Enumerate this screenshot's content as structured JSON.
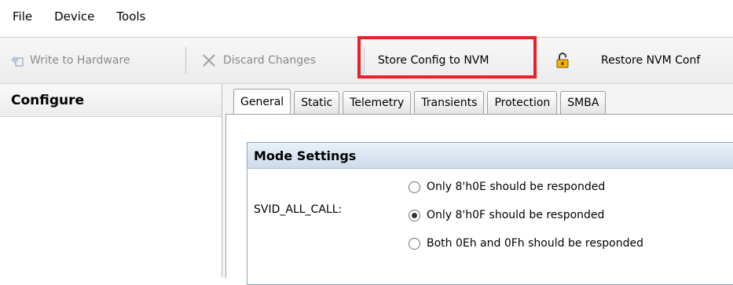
{
  "menu": [
    "File",
    "Device",
    "Tools"
  ],
  "toolbar": {
    "write": "Write to Hardware",
    "discard": "Discard Changes",
    "store": "Store Config to NVM",
    "restore": "Restore NVM Conf"
  },
  "left_panel": {
    "title": "Configure"
  },
  "tabs": [
    "General",
    "Static",
    "Telemetry",
    "Transients",
    "Protection",
    "SMBA"
  ],
  "group": {
    "title": "Mode Settings",
    "field_label": "SVID_ALL_CALL:",
    "options": [
      "Only 8'h0E should be responded",
      "Only 8'h0F should be responded",
      "Both 0Eh and 0Fh should be responded"
    ],
    "selected_index": 1
  },
  "colors": {
    "highlight": "#e8202a",
    "group_border": "#8fa5c0"
  }
}
